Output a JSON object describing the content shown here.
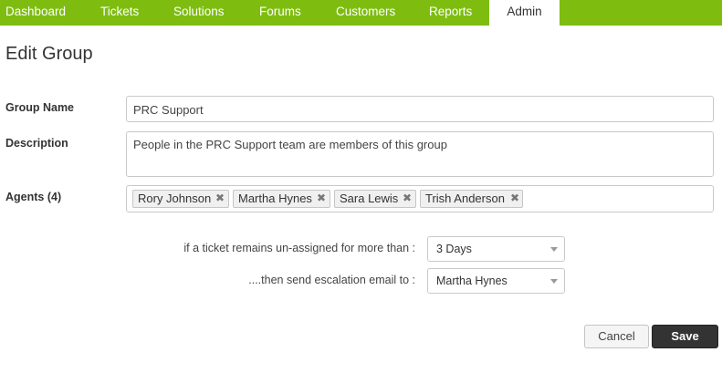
{
  "nav": {
    "items": [
      {
        "label": "Dashboard"
      },
      {
        "label": "Tickets"
      },
      {
        "label": "Solutions"
      },
      {
        "label": "Forums"
      },
      {
        "label": "Customers"
      },
      {
        "label": "Reports"
      },
      {
        "label": "Admin",
        "active": true
      }
    ]
  },
  "page_title": "Edit Group",
  "form": {
    "group_name_label": "Group Name",
    "group_name_value": "PRC Support",
    "description_label": "Description",
    "description_value": "People in the PRC Support team are members of this group",
    "agents_label": "Agents (4)",
    "agents": [
      "Rory Johnson",
      "Martha Hynes",
      "Sara Lewis",
      "Trish Anderson"
    ],
    "tag_remove_glyph": "✖",
    "escalation": {
      "unassigned_label": "if a ticket remains un-assigned for more than :",
      "unassigned_value": "3 Days",
      "email_label": "....then send escalation email to :",
      "email_value": "Martha Hynes"
    }
  },
  "buttons": {
    "cancel_label": "Cancel",
    "save_label": "Save"
  },
  "colors": {
    "nav_bg": "#7ebd10",
    "save_bg": "#333333"
  }
}
